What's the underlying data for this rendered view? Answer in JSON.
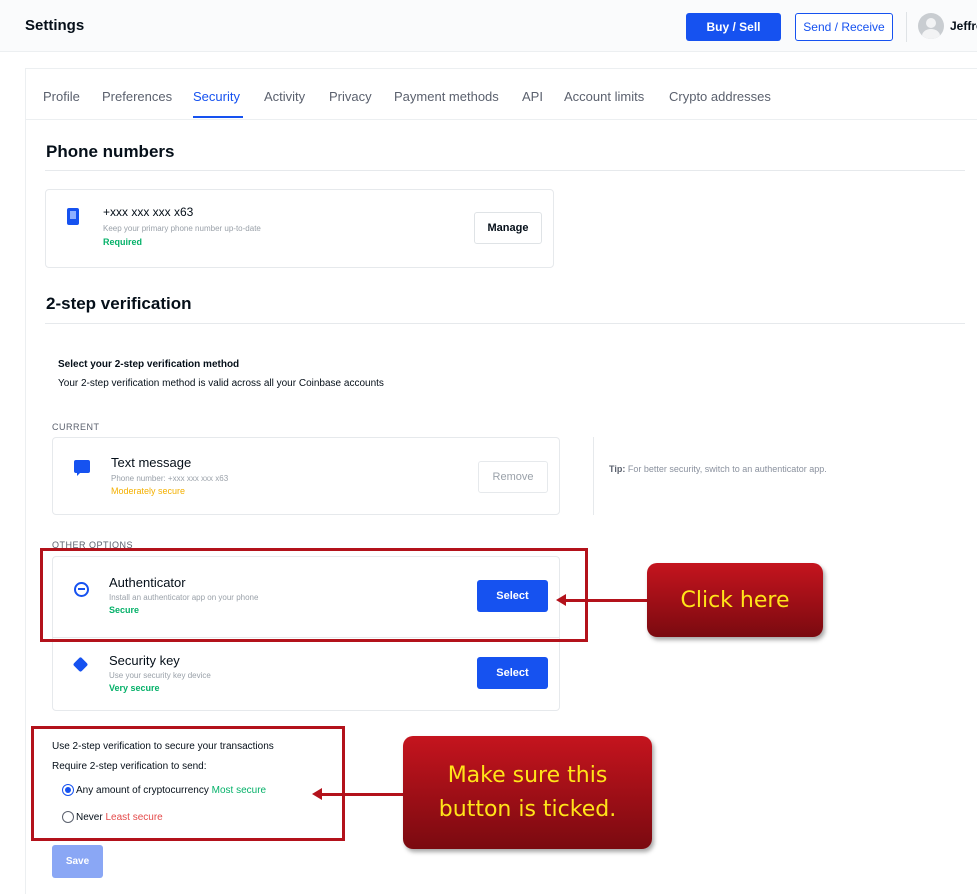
{
  "header": {
    "title": "Settings",
    "buy_sell_label": "Buy / Sell",
    "send_receive_label": "Send / Receive",
    "user_name": "Jeffre"
  },
  "tabs": [
    {
      "label": "Profile"
    },
    {
      "label": "Preferences"
    },
    {
      "label": "Security",
      "active": true
    },
    {
      "label": "Activity"
    },
    {
      "label": "Privacy"
    },
    {
      "label": "Payment methods"
    },
    {
      "label": "API"
    },
    {
      "label": "Account limits"
    },
    {
      "label": "Crypto addresses"
    }
  ],
  "phone_section": {
    "heading": "Phone numbers",
    "number": "+xxx xxx xxx x63",
    "hint": "Keep your primary phone number up-to-date",
    "status": "Required",
    "manage_label": "Manage"
  },
  "two_step": {
    "heading": "2-step verification",
    "select_title": "Select your 2-step verification method",
    "select_desc": "Your 2-step verification method is valid across all your Coinbase accounts",
    "current_label": "CURRENT",
    "current": {
      "name": "Text message",
      "detail": "Phone number: +xxx xxx xxx x63",
      "level": "Moderately secure",
      "remove_label": "Remove"
    },
    "tip_bold": "Tip:",
    "tip_text": "For better security, switch to an authenticator app.",
    "other_label": "OTHER OPTIONS",
    "options": [
      {
        "name": "Authenticator",
        "detail": "Install an authenticator app on your phone",
        "level": "Secure",
        "button": "Select"
      },
      {
        "name": "Security key",
        "detail": "Use your security key device",
        "level": "Very secure",
        "button": "Select"
      }
    ]
  },
  "transactions": {
    "title": "Use 2-step verification to secure your transactions",
    "require_label": "Require 2-step verification to send:",
    "option_any": "Any amount of cryptocurrency",
    "option_any_tag": "Most secure",
    "option_never": "Never",
    "option_never_tag": "Least secure",
    "selected": "any",
    "save_label": "Save"
  },
  "annotations": {
    "click_here": "Click here",
    "tick_line1": "Make sure this",
    "tick_line2": "button is ticked."
  },
  "colors": {
    "accent": "#1652f0",
    "secure_green": "#05b169",
    "moderate_orange": "#f4b000",
    "least_red": "#e44a4a",
    "annotation_red": "#b3121b",
    "annotation_text": "#ffe419"
  }
}
